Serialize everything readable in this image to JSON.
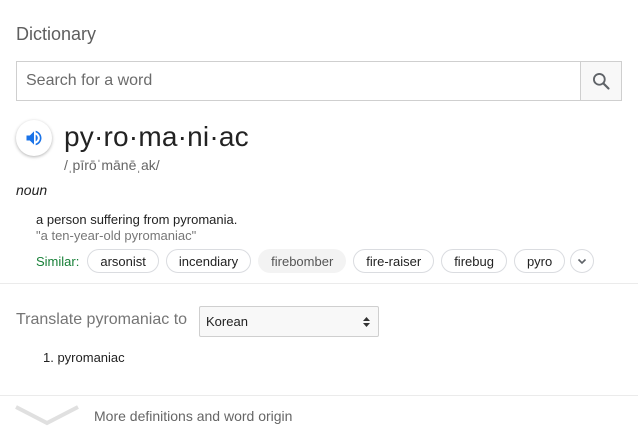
{
  "header": {
    "title": "Dictionary"
  },
  "search": {
    "placeholder": "Search for a word",
    "value": ""
  },
  "entry": {
    "word": "py·ro·ma·ni·ac",
    "phonetic": "/ˌpīrōˈmānēˌak/",
    "part_of_speech": "noun",
    "definition": "a person suffering from pyromania.",
    "example": "\"a ten-year-old pyromaniac\"",
    "similar_label": "Similar:",
    "similar": [
      "arsonist",
      "incendiary",
      "firebomber",
      "fire-raiser",
      "firebug",
      "pyro"
    ]
  },
  "translate": {
    "label": "Translate pyromaniac to",
    "selected_language": "Korean",
    "results": [
      "1. pyromaniac"
    ]
  },
  "footer": {
    "more_label": "More definitions and word origin"
  },
  "colors": {
    "similar_label": "#188038",
    "audio_icon": "#1a73e8"
  }
}
